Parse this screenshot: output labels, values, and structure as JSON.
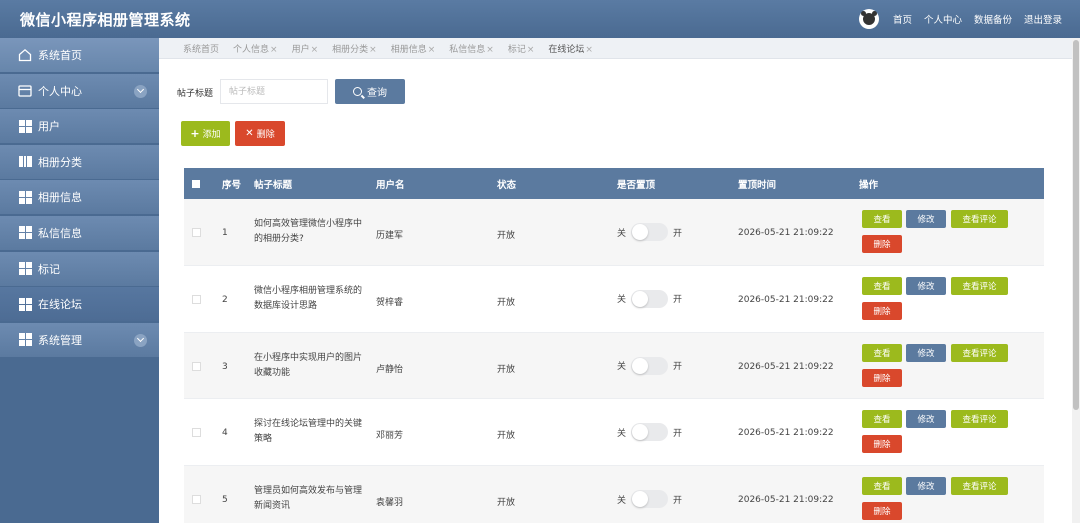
{
  "header": {
    "title": "微信小程序相册管理系统",
    "links": [
      "首页",
      "个人中心",
      "数据备份",
      "退出登录"
    ]
  },
  "sidebar": {
    "items": [
      {
        "label": "系统首页",
        "icon": "home-icon"
      },
      {
        "label": "个人中心",
        "icon": "card-icon",
        "expandable": true
      },
      {
        "label": "用户",
        "icon": "grid-icon"
      },
      {
        "label": "相册分类",
        "icon": "book-icon"
      },
      {
        "label": "相册信息",
        "icon": "grid-icon"
      },
      {
        "label": "私信信息",
        "icon": "grid-icon"
      },
      {
        "label": "标记",
        "icon": "grid-icon"
      },
      {
        "label": "在线论坛",
        "icon": "grid-icon",
        "active": true
      },
      {
        "label": "系统管理",
        "icon": "grid-icon",
        "expandable": true
      }
    ]
  },
  "tabs": [
    {
      "label": "系统首页",
      "closable": false
    },
    {
      "label": "个人信息",
      "closable": true
    },
    {
      "label": "用户",
      "closable": true
    },
    {
      "label": "相册分类",
      "closable": true
    },
    {
      "label": "相册信息",
      "closable": true
    },
    {
      "label": "私信信息",
      "closable": true
    },
    {
      "label": "标记",
      "closable": true
    },
    {
      "label": "在线论坛",
      "closable": true,
      "active": true
    }
  ],
  "search": {
    "label": "帖子标题",
    "placeholder": "帖子标题",
    "button": "查询"
  },
  "actions": {
    "add": "添加",
    "delete": "删除"
  },
  "table": {
    "columns": [
      "序号",
      "帖子标题",
      "用户名",
      "状态",
      "是否置顶",
      "置顶时间",
      "操作"
    ],
    "switch_off": "关",
    "switch_on": "开",
    "op_view": "查看",
    "op_edit": "修改",
    "op_comment": "查看评论",
    "op_delete": "删除",
    "rows": [
      {
        "no": "1",
        "title": "如何高效管理微信小程序中的相册分类?",
        "user": "历建军",
        "status": "开放",
        "pinned": false,
        "time": "2026-05-21 21:09:22"
      },
      {
        "no": "2",
        "title": "微信小程序相册管理系统的数据库设计思路",
        "user": "贺梓睿",
        "status": "开放",
        "pinned": false,
        "time": "2026-05-21 21:09:22"
      },
      {
        "no": "3",
        "title": "在小程序中实现用户的图片收藏功能",
        "user": "卢静怡",
        "status": "开放",
        "pinned": false,
        "time": "2026-05-21 21:09:22"
      },
      {
        "no": "4",
        "title": "探讨在线论坛管理中的关键策略",
        "user": "邓丽芳",
        "status": "开放",
        "pinned": false,
        "time": "2026-05-21 21:09:22"
      },
      {
        "no": "5",
        "title": "管理员如何高效发布与管理新闻资讯",
        "user": "袁馨羽",
        "status": "开放",
        "pinned": false,
        "time": "2026-05-21 21:09:22"
      }
    ]
  },
  "colors": {
    "header": "#4a6a91",
    "primary": "#5b7a9f",
    "success": "#9cba1d",
    "danger": "#d9482c"
  }
}
